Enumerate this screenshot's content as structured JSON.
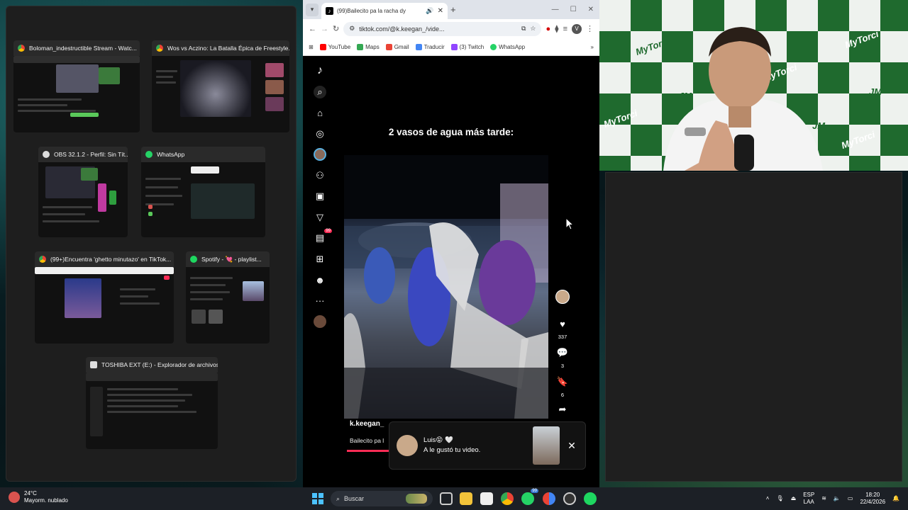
{
  "task_view": {
    "windows": [
      {
        "title": "Boloman_indestructible Stream - Watc...",
        "icon": "chrome-icon"
      },
      {
        "title": "Wos vs Aczino: La Batalla Épica de Freestyle...",
        "icon": "chrome-icon"
      },
      {
        "title": "OBS 32.1.2 - Perfil: Sin Tít...",
        "icon": "obs-icon"
      },
      {
        "title": "WhatsApp",
        "icon": "whatsapp-icon"
      },
      {
        "title": "(99+)Encuentra 'ghetto minutazo' en TikTok...",
        "icon": "chrome-icon"
      },
      {
        "title": "Spotify - 💘 - playlist...",
        "icon": "spotify-icon"
      },
      {
        "title": "TOSHIBA EXT (E:) - Explorador de archivos",
        "icon": "file-explorer-icon"
      }
    ]
  },
  "browser": {
    "tab_title": "(99)Bailecito pa la racha dy",
    "url": "tiktok.com/@k.keegan_/vide...",
    "bookmarks": [
      "YouTube",
      "Maps",
      "Gmail",
      "Traducir",
      "(3) Twitch",
      "WhatsApp"
    ],
    "profile_initial": "V"
  },
  "tiktok": {
    "inbox_badge": "99",
    "caption": "2 vasos de agua más tarde:",
    "likes": "337",
    "comments": "3",
    "saves": "6",
    "author": "k.keegan_",
    "description": "Bailecito pa l",
    "notification": {
      "name": "Luis😝 🤍",
      "message": "A le gustó tu video."
    }
  },
  "webcam": {
    "brand_text": "MyTorci",
    "logo_text": "JM"
  },
  "taskbar": {
    "temperature": "24°C",
    "weather": "Mayorm. nublado",
    "search_placeholder": "Buscar",
    "lang_top": "ESP",
    "lang_bottom": "LAA",
    "time": "18:20",
    "date": "22/4/2026",
    "badge": "99"
  },
  "colors": {
    "tiktok_pink": "#fe2c55",
    "webcam_green": "#1f6a2e",
    "windows_accent": "#4cc2ff"
  }
}
